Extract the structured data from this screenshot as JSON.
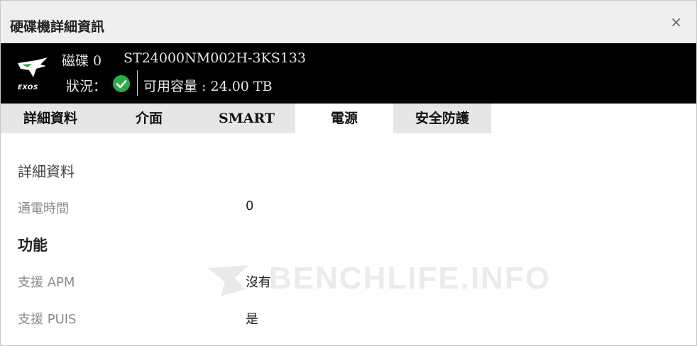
{
  "window": {
    "title": "硬碟機詳細資訊",
    "close_glyph": "×"
  },
  "header": {
    "logo_icon": "exos-logo",
    "logo_text": "EXOS",
    "disk_label": "磁碟 0",
    "model": "ST24000NM002H-3KS133",
    "status_label": "狀況：",
    "status_icon": "check-circle-icon",
    "status_color": "#2eaa4f",
    "capacity": "可用容量 : 24.00 TB"
  },
  "tabs": [
    {
      "label": "詳細資料",
      "active": false
    },
    {
      "label": "介面",
      "active": false
    },
    {
      "label": "SMART",
      "active": false
    },
    {
      "label": "電源",
      "active": true
    },
    {
      "label": "安全防護",
      "active": false
    }
  ],
  "content": {
    "section1_title": "詳細資料",
    "power_on_label": "通電時間",
    "power_on_value": "0",
    "section2_title": "功能",
    "apm_label": "支援 APM",
    "apm_value": "沒有",
    "puis_label": "支援 PUIS",
    "puis_value": "是"
  },
  "watermark": {
    "text": "BENCHLIFE.INFO"
  }
}
